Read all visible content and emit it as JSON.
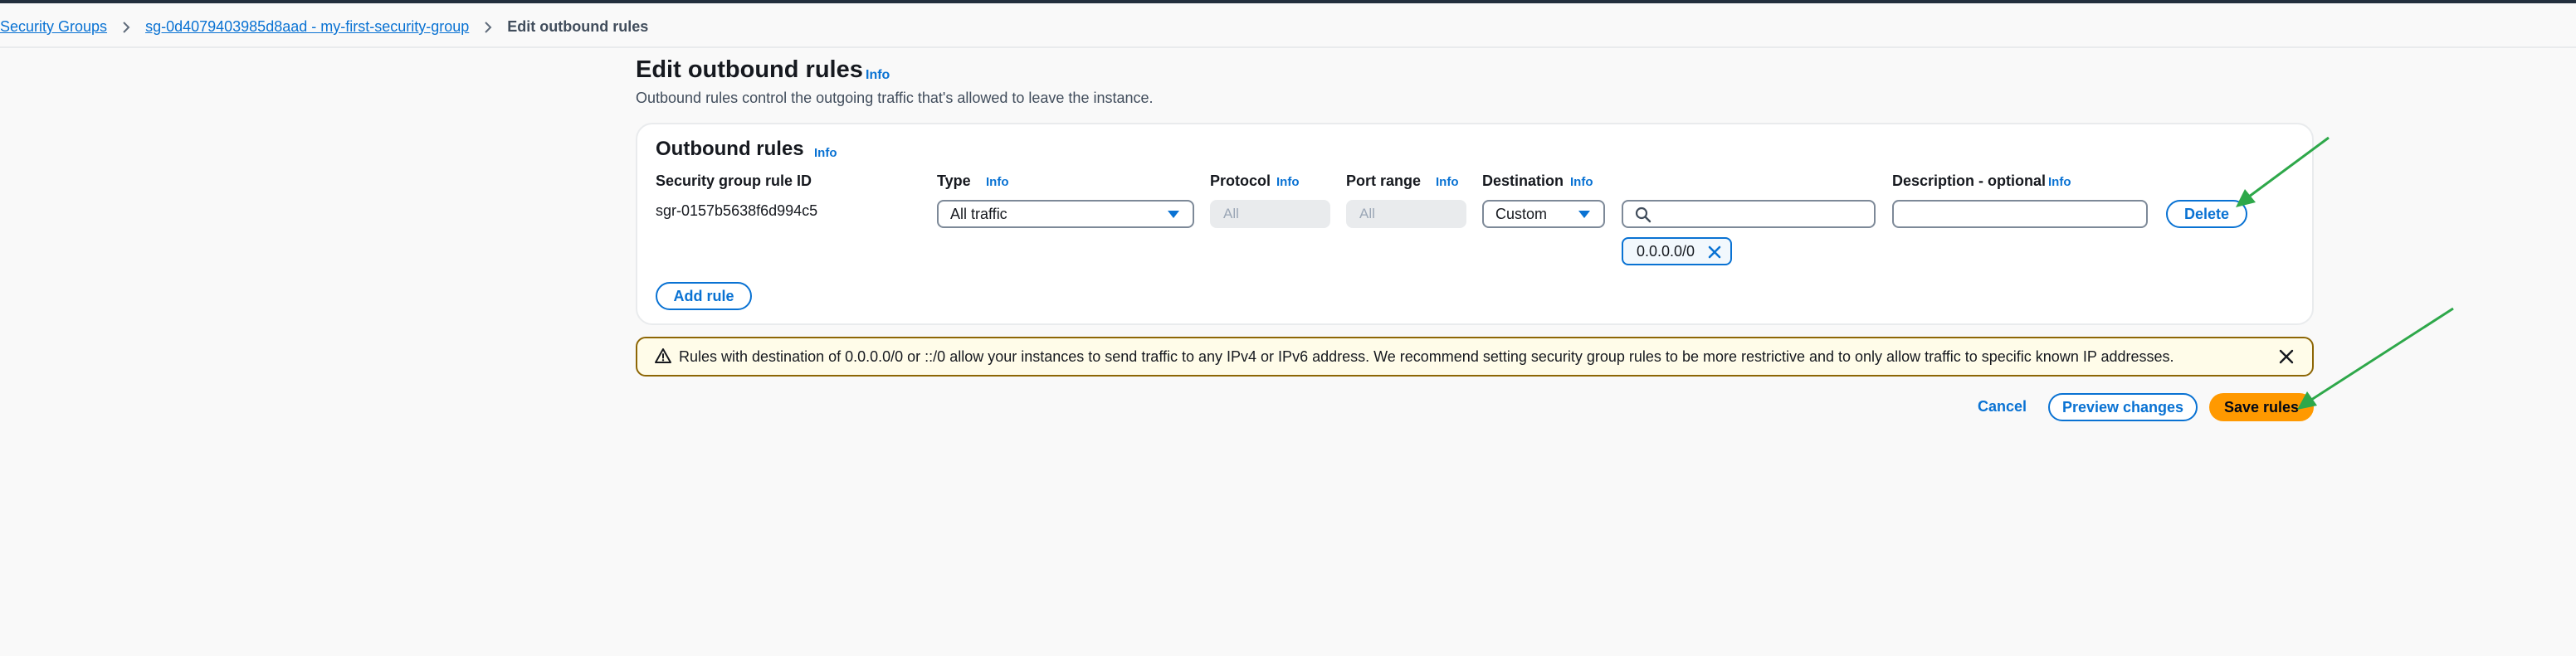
{
  "breadcrumb": {
    "items": [
      "Security Groups",
      "sg-0d4079403985d8aad - my-first-security-group"
    ],
    "current": "Edit outbound rules"
  },
  "page": {
    "title": "Edit outbound rules",
    "info": "Info",
    "description": "Outbound rules control the outgoing traffic that's allowed to leave the instance."
  },
  "panel": {
    "title": "Outbound rules",
    "info": "Info",
    "columns": {
      "rule_id": "Security group rule ID",
      "type": "Type",
      "protocol": "Protocol",
      "port_range": "Port range",
      "destination": "Destination",
      "description": "Description - optional"
    },
    "info_label": "Info",
    "rule": {
      "id": "sgr-0157b5638f6d994c5",
      "type": "All traffic",
      "protocol": "All",
      "port_range": "All",
      "destination_mode": "Custom",
      "destination_token": "0.0.0.0/0",
      "description": ""
    },
    "delete_label": "Delete",
    "add_rule_label": "Add rule"
  },
  "alert": {
    "text": "Rules with destination of 0.0.0.0/0 or ::/0 allow your instances to send traffic to any IPv4 or IPv6 address. We recommend setting security group rules to be more restrictive and to only allow traffic to specific known IP addresses."
  },
  "actions": {
    "cancel": "Cancel",
    "preview": "Preview changes",
    "save": "Save rules"
  },
  "icons": {
    "breadcrumb_separator": "chevron-right-icon",
    "dropdown": "caret-down-icon",
    "search": "search-icon",
    "token_remove": "close-icon",
    "alert": "warning-icon",
    "alert_close": "close-icon",
    "annotation": "arrow-icon"
  },
  "colors": {
    "link": "#0972d3",
    "primary_button": "#ff9900",
    "warning_border": "#8d6605",
    "warning_background": "#fffce9",
    "annotation_arrow": "#2ea84a"
  }
}
